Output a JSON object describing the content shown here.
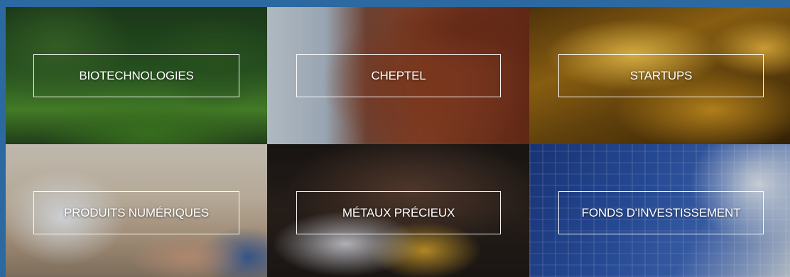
{
  "tiles": [
    {
      "label": "BIOTECHNOLOGIES",
      "image": "cannabis-leaves-photo"
    },
    {
      "label": "CHEPTEL",
      "image": "highland-cattle-photo"
    },
    {
      "label": "STARTUPS",
      "image": "gold-bars-photo"
    },
    {
      "label": "PRODUITS NUMÉRIQUES",
      "image": "laptop-typing-photo"
    },
    {
      "label": "MÉTAUX PRÉCIEUX",
      "image": "crypto-coins-in-hand-photo"
    },
    {
      "label": "FONDS D'INVESTISSEMENT",
      "image": "glass-skyscraper-photo"
    }
  ],
  "colors": {
    "frame": "#2c69a1",
    "label_text": "#ffffff",
    "label_border": "#ffffff"
  }
}
